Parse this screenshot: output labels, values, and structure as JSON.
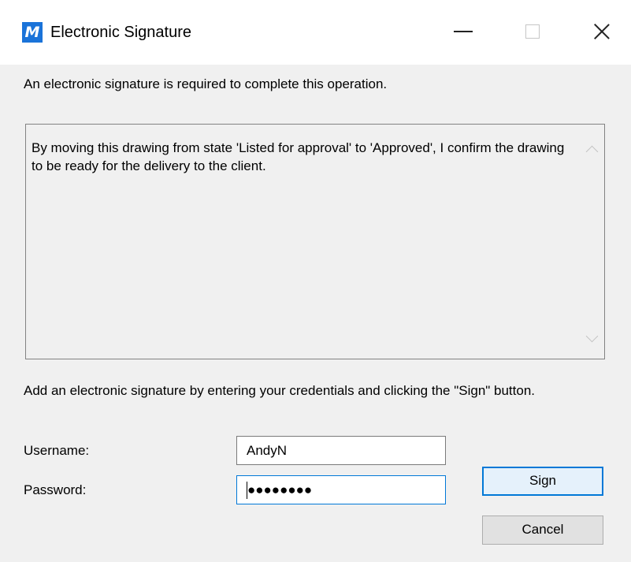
{
  "window": {
    "title": "Electronic Signature",
    "logo_letter": "M",
    "accent_color": "#1a73d9"
  },
  "intro_text": "An electronic signature is required to complete this operation.",
  "message": "By moving this drawing from state 'Listed for approval' to 'Approved', I confirm the drawing to be ready for the delivery to the client.",
  "instruction_text": "Add an electronic signature by entering your credentials and clicking the \"Sign\" button.",
  "form": {
    "username_label": "Username:",
    "username_value": "AndyN",
    "password_label": "Password:",
    "password_masked": "●●●●●●●●"
  },
  "buttons": {
    "sign": "Sign",
    "cancel": "Cancel"
  }
}
